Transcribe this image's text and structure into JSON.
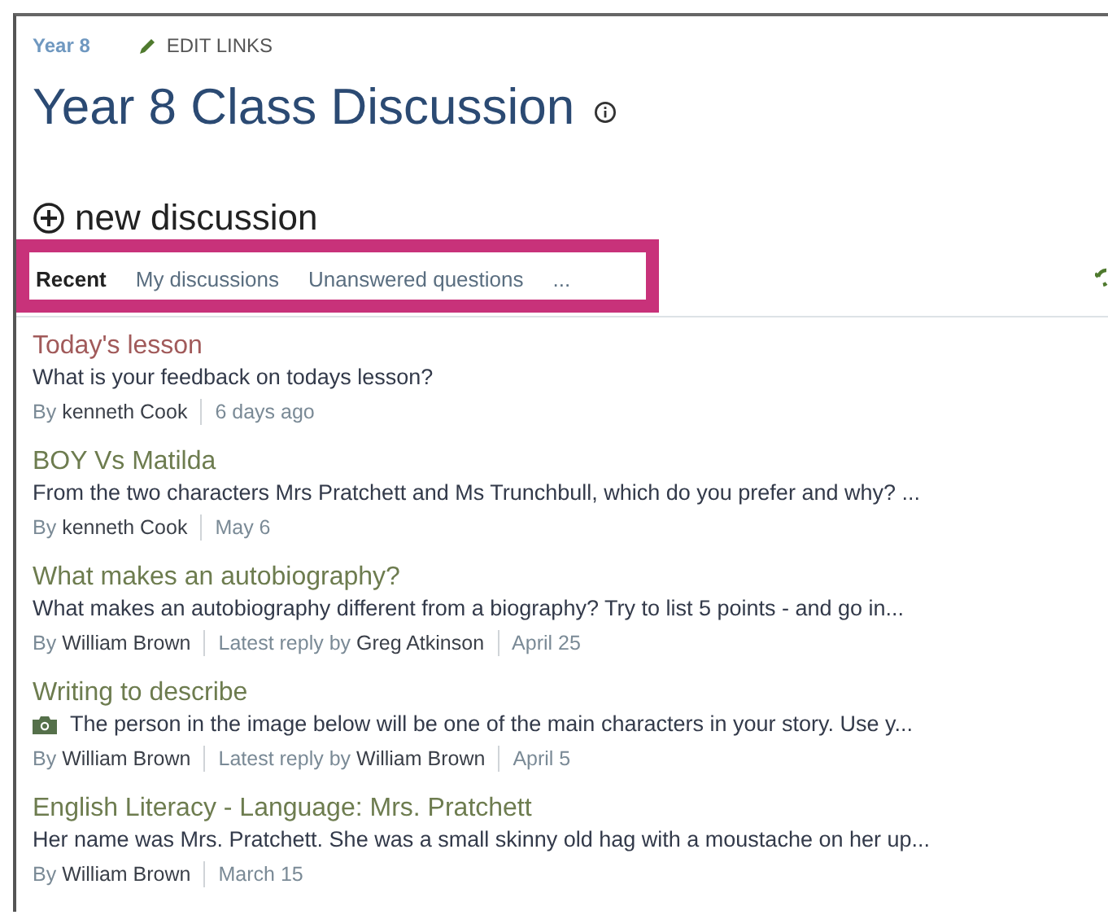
{
  "breadcrumb": {
    "label": "Year 8"
  },
  "edit_links": {
    "label": "EDIT LINKS"
  },
  "title": "Year 8 Class Discussion",
  "new_discussion": {
    "label": "new discussion"
  },
  "tab_bar": {
    "highlighted": true,
    "tabs": [
      {
        "label": "Recent",
        "selected": true
      },
      {
        "label": "My discussions",
        "selected": false
      },
      {
        "label": "Unanswered questions",
        "selected": false
      },
      {
        "label": "...",
        "selected": false
      }
    ]
  },
  "discussions": [
    {
      "title": "Today's lesson",
      "visited": true,
      "has_image": false,
      "summary": "What is your feedback on todays lesson?",
      "meta": [
        {
          "prefix": "By",
          "name": "kenneth Cook"
        },
        {
          "text": "6 days ago"
        }
      ]
    },
    {
      "title": "BOY Vs Matilda",
      "visited": false,
      "has_image": false,
      "summary": "From the two characters Mrs Pratchett and Ms Trunchbull, which do you prefer and why? ...",
      "meta": [
        {
          "prefix": "By",
          "name": "kenneth Cook"
        },
        {
          "text": "May 6"
        }
      ]
    },
    {
      "title": "What makes an autobiography?",
      "visited": false,
      "has_image": false,
      "summary": "What makes an autobiography different from a biography? Try to list 5 points - and go in...",
      "meta": [
        {
          "prefix": "By",
          "name": "William Brown"
        },
        {
          "prefix": "Latest reply by",
          "name": "Greg Atkinson"
        },
        {
          "text": "April 25"
        }
      ]
    },
    {
      "title": "Writing to describe",
      "visited": false,
      "has_image": true,
      "summary": "The person in the image below will be one of the main characters in your story. Use y...",
      "meta": [
        {
          "prefix": "By",
          "name": "William Brown"
        },
        {
          "prefix": "Latest reply by",
          "name": "William Brown"
        },
        {
          "text": "April 5"
        }
      ]
    },
    {
      "title": "English Literacy - Language: Mrs. Pratchett",
      "visited": false,
      "has_image": false,
      "summary": "Her name was Mrs. Pratchett. She was a small skinny old hag with a moustache on her up...",
      "meta": [
        {
          "prefix": "By",
          "name": "William Brown"
        },
        {
          "text": "March 15"
        }
      ]
    }
  ]
}
